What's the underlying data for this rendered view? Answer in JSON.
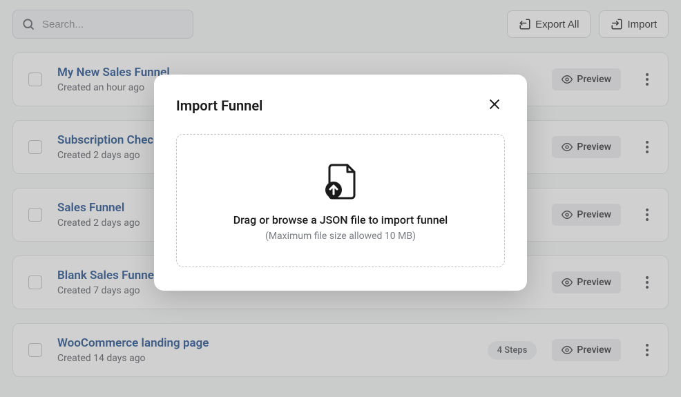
{
  "toolbar": {
    "search_placeholder": "Search...",
    "export_all_label": "Export All",
    "import_label": "Import"
  },
  "funnels": [
    {
      "title": "My New Sales Funnel",
      "subtitle": "Created an hour ago",
      "steps_label": "",
      "preview_label": "Preview"
    },
    {
      "title": "Subscription Checkout",
      "subtitle": "Created 2 days ago",
      "steps_label": "",
      "preview_label": "Preview"
    },
    {
      "title": "Sales Funnel",
      "subtitle": "Created 2 days ago",
      "steps_label": "",
      "preview_label": "Preview"
    },
    {
      "title": "Blank Sales Funnel",
      "subtitle": "Created 7 days ago",
      "steps_label": "",
      "preview_label": "Preview"
    },
    {
      "title": "WooCommerce landing page",
      "subtitle": "Created 14 days ago",
      "steps_label": "4 Steps",
      "preview_label": "Preview"
    }
  ],
  "modal": {
    "title": "Import Funnel",
    "dropzone_text": "Drag or browse a JSON file to import funnel",
    "dropzone_sub": "(Maximum file size allowed 10 MB)"
  }
}
